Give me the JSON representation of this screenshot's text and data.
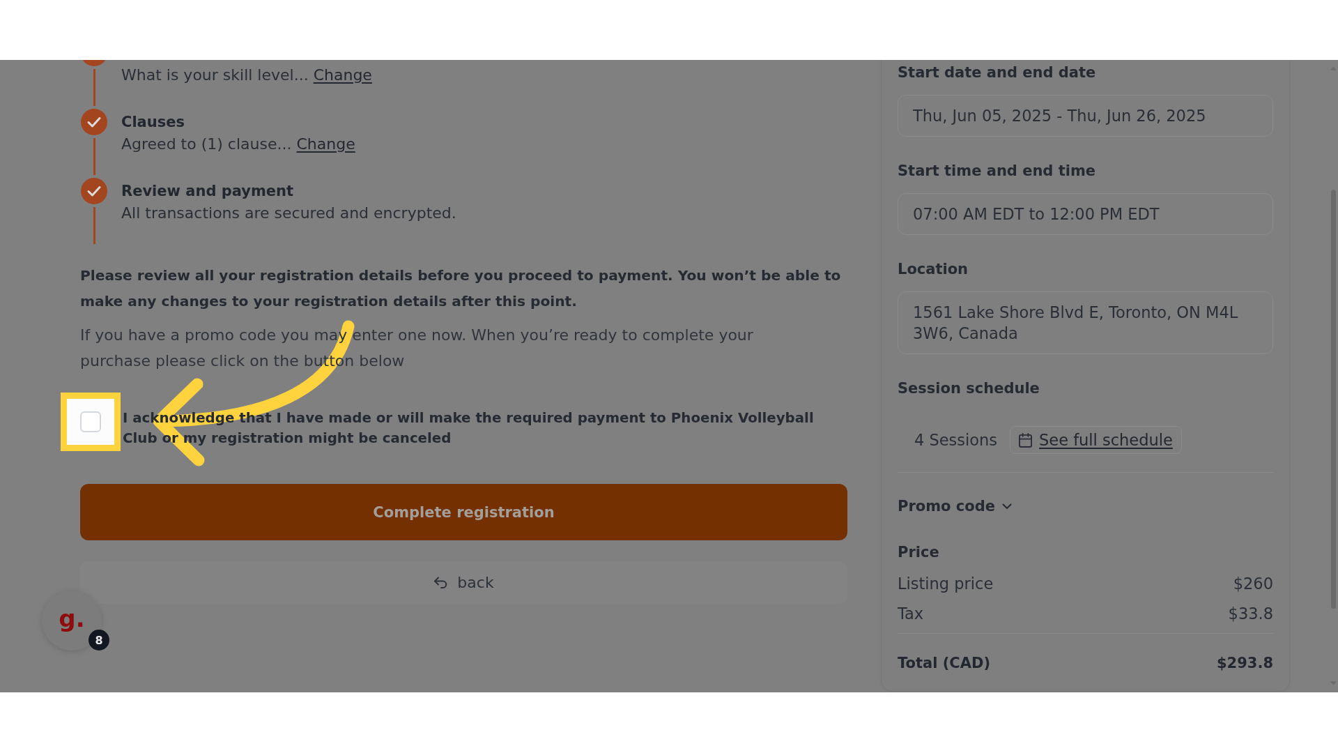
{
  "steps": [
    {
      "subtitle": "What is your skill level...",
      "link": "Change",
      "completed": true
    },
    {
      "title": "Clauses",
      "subtitle": "Agreed to (1) clause...",
      "link": "Change",
      "completed": true
    },
    {
      "title": "Review and payment",
      "subtitle": "All transactions are secured and encrypted.",
      "completed": true
    }
  ],
  "review_notice": "Please review all your registration details before you proceed to payment. You won’t be able to make any changes to your registration details after this point.",
  "promo_hint": "If you have a promo code you may enter one now. When you’re ready to complete your purchase please click on the button below",
  "acknowledgment": {
    "text": "I acknowledge that I have made or will make the required payment to Phoenix Volleyball Club or my registration might be canceled",
    "checked": false
  },
  "complete_button": "Complete registration",
  "back_button": "back",
  "chat_widget": {
    "logo": "g.",
    "badge": "8"
  },
  "summary": {
    "fields": [
      {
        "label": "Start date and end date",
        "value": "Thu, Jun 05, 2025 - Thu, Jun 26, 2025"
      },
      {
        "label": "Start time and end time",
        "value": "07:00 AM EDT to 12:00 PM EDT"
      },
      {
        "label": "Location",
        "value": "1561 Lake Shore Blvd E, Toronto, ON M4L 3W6, Canada"
      }
    ],
    "session_schedule": {
      "label": "Session schedule",
      "count": "4 Sessions",
      "link": "See full schedule"
    },
    "promo_code": {
      "label": "Promo code",
      "expanded": false
    },
    "price": {
      "title": "Price",
      "lines": [
        {
          "label": "Listing price",
          "amount": "$260"
        },
        {
          "label": "Tax",
          "amount": "$33.8"
        }
      ],
      "total": {
        "label": "Total (CAD)",
        "amount": "$293.8"
      }
    }
  }
}
